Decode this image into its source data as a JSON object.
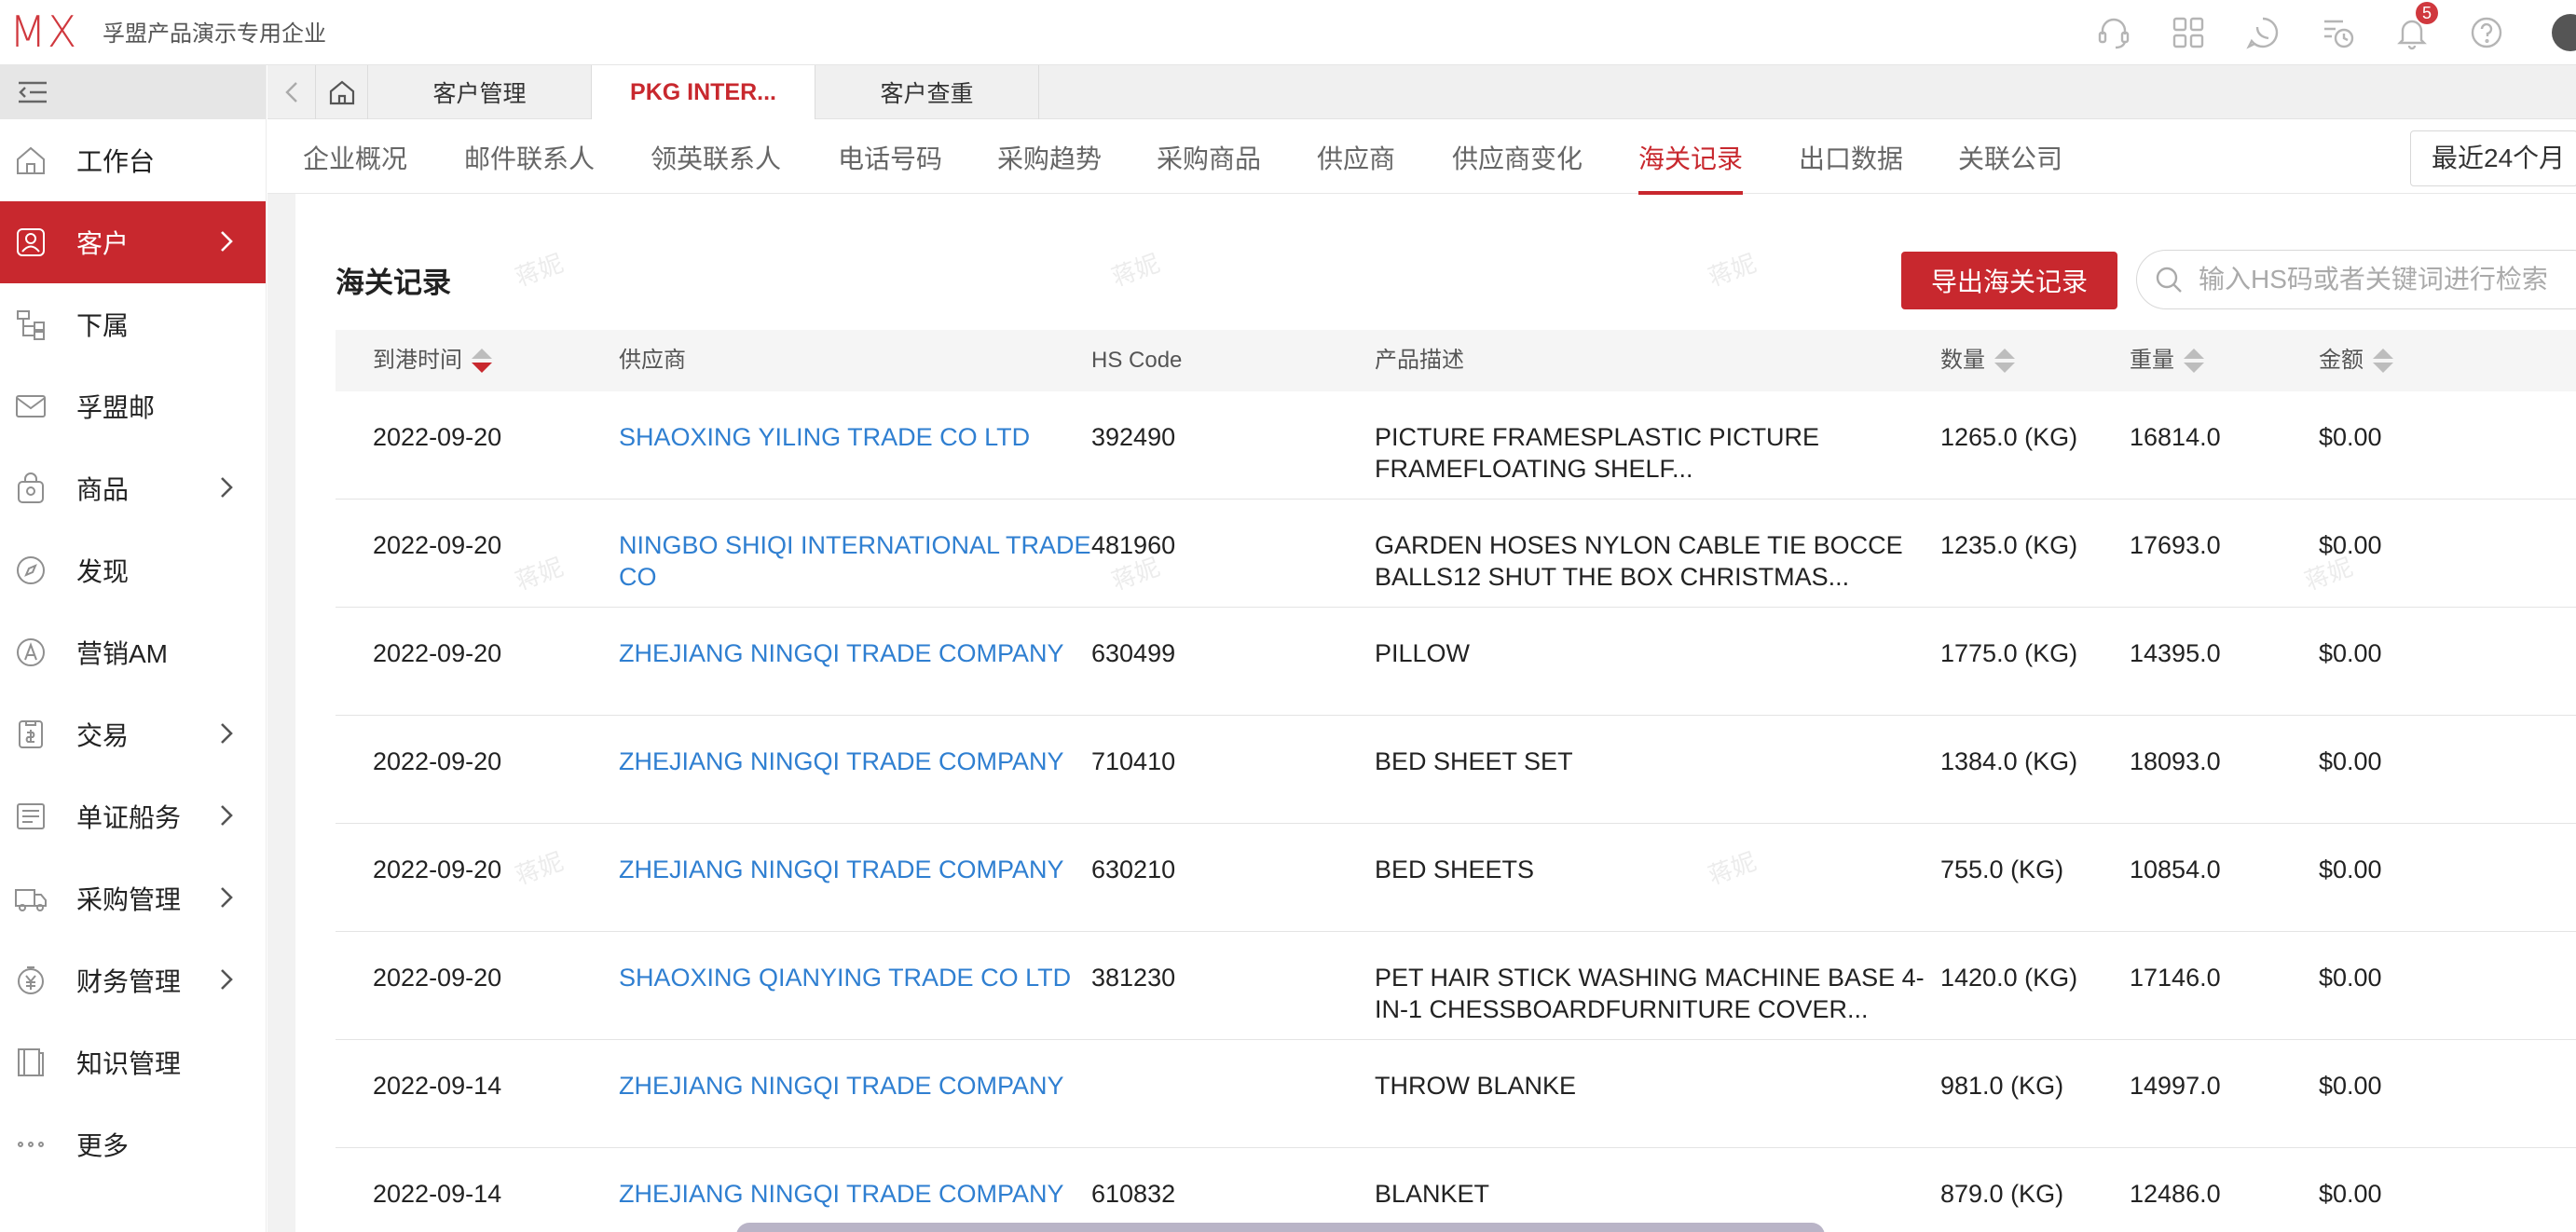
{
  "app": {
    "logo": "MX",
    "company": "孚盟产品演示专用企业",
    "notification_count": "5",
    "top_icons": [
      "headset-icon",
      "apps-grid-icon",
      "whatsapp-icon",
      "history-icon",
      "bell-icon",
      "help-icon"
    ]
  },
  "sidebar": {
    "items": [
      {
        "label": "工作台",
        "icon": "home-icon",
        "chevron": false,
        "active": false
      },
      {
        "label": "客户",
        "icon": "customer-icon",
        "chevron": true,
        "active": true
      },
      {
        "label": "下属",
        "icon": "org-icon",
        "chevron": false,
        "active": false
      },
      {
        "label": "孚盟邮",
        "icon": "mail-icon",
        "chevron": false,
        "active": false
      },
      {
        "label": "商品",
        "icon": "bag-icon",
        "chevron": true,
        "active": false
      },
      {
        "label": "发现",
        "icon": "compass-icon",
        "chevron": false,
        "active": false
      },
      {
        "label": "营销AM",
        "icon": "marketing-icon",
        "chevron": false,
        "active": false
      },
      {
        "label": "交易",
        "icon": "trade-icon",
        "chevron": true,
        "active": false
      },
      {
        "label": "单证船务",
        "icon": "document-icon",
        "chevron": true,
        "active": false
      },
      {
        "label": "采购管理",
        "icon": "truck-icon",
        "chevron": true,
        "active": false
      },
      {
        "label": "财务管理",
        "icon": "finance-icon",
        "chevron": true,
        "active": false
      },
      {
        "label": "知识管理",
        "icon": "book-icon",
        "chevron": false,
        "active": false
      },
      {
        "label": "更多",
        "icon": "more-icon",
        "chevron": false,
        "active": false
      }
    ]
  },
  "tabs": [
    {
      "label": "客户管理",
      "active": false
    },
    {
      "label": "PKG INTER...",
      "active": true
    },
    {
      "label": "客户查重",
      "active": false
    }
  ],
  "subtabs": [
    {
      "label": "企业概况",
      "active": false
    },
    {
      "label": "邮件联系人",
      "active": false
    },
    {
      "label": "领英联系人",
      "active": false
    },
    {
      "label": "电话号码",
      "active": false
    },
    {
      "label": "采购趋势",
      "active": false
    },
    {
      "label": "采购商品",
      "active": false
    },
    {
      "label": "供应商",
      "active": false
    },
    {
      "label": "供应商变化",
      "active": false
    },
    {
      "label": "海关记录",
      "active": true
    },
    {
      "label": "出口数据",
      "active": false
    },
    {
      "label": "关联公司",
      "active": false
    }
  ],
  "period_selector": "最近24个月",
  "section": {
    "title": "海关记录",
    "export_label": "导出海关记录",
    "search_placeholder": "输入HS码或者关键词进行检索"
  },
  "table": {
    "headers": {
      "date": "到港时间",
      "supplier": "供应商",
      "hs_code": "HS Code",
      "description": "产品描述",
      "quantity": "数量",
      "weight": "重量",
      "amount": "金额"
    },
    "rows": [
      {
        "date": "2022-09-20",
        "supplier": "SHAOXING YILING TRADE CO LTD",
        "hs_code": "392490",
        "description": "PICTURE FRAMESPLASTIC PICTURE FRAMEFLOATING SHELF...",
        "quantity": "1265.0 (KG)",
        "weight": "16814.0",
        "amount": "$0.00"
      },
      {
        "date": "2022-09-20",
        "supplier": "NINGBO SHIQI INTERNATIONAL TRADE CO",
        "hs_code": "481960",
        "description": "GARDEN HOSES NYLON CABLE TIE BOCCE BALLS12 SHUT THE BOX CHRISTMAS...",
        "quantity": "1235.0 (KG)",
        "weight": "17693.0",
        "amount": "$0.00"
      },
      {
        "date": "2022-09-20",
        "supplier": "ZHEJIANG NINGQI TRADE COMPANY",
        "hs_code": "630499",
        "description": "PILLOW",
        "quantity": "1775.0 (KG)",
        "weight": "14395.0",
        "amount": "$0.00"
      },
      {
        "date": "2022-09-20",
        "supplier": "ZHEJIANG NINGQI TRADE COMPANY",
        "hs_code": "710410",
        "description": "BED SHEET SET",
        "quantity": "1384.0 (KG)",
        "weight": "18093.0",
        "amount": "$0.00"
      },
      {
        "date": "2022-09-20",
        "supplier": "ZHEJIANG NINGQI TRADE COMPANY",
        "hs_code": "630210",
        "description": "BED SHEETS",
        "quantity": "755.0 (KG)",
        "weight": "10854.0",
        "amount": "$0.00"
      },
      {
        "date": "2022-09-20",
        "supplier": "SHAOXING QIANYING TRADE CO LTD",
        "hs_code": "381230",
        "description": "PET HAIR STICK WASHING MACHINE BASE 4-IN-1 CHESSBOARDFURNITURE COVER...",
        "quantity": "1420.0 (KG)",
        "weight": "17146.0",
        "amount": "$0.00"
      },
      {
        "date": "2022-09-14",
        "supplier": "ZHEJIANG NINGQI TRADE COMPANY",
        "hs_code": "",
        "description": "THROW BLANKE",
        "quantity": "981.0 (KG)",
        "weight": "14997.0",
        "amount": "$0.00"
      },
      {
        "date": "2022-09-14",
        "supplier": "ZHEJIANG NINGQI TRADE COMPANY",
        "hs_code": "610832",
        "description": "BLANKET",
        "quantity": "879.0 (KG)",
        "weight": "12486.0",
        "amount": "$0.00"
      }
    ]
  },
  "watermark": "蒋妮",
  "colors": {
    "accent": "#c8282e",
    "link": "#2f7fd1"
  }
}
